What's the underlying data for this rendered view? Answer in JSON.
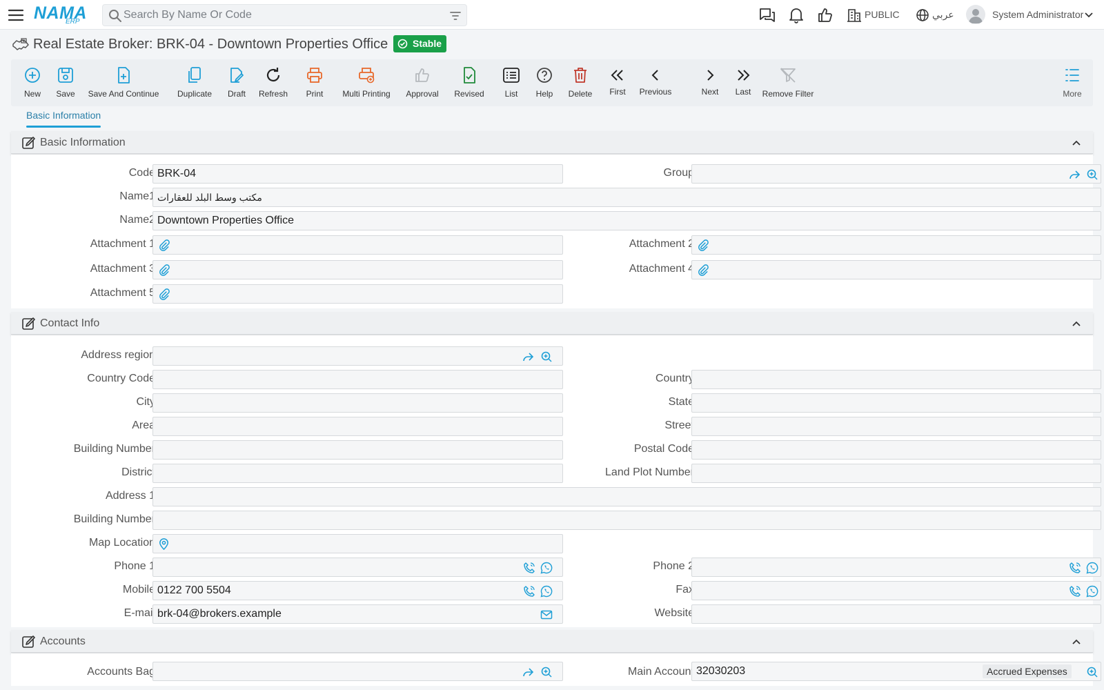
{
  "topbar": {
    "logo_main": "NAMA",
    "logo_sub": "ERP",
    "search_placeholder": "Search By Name Or Code",
    "branch": "PUBLIC",
    "language": "عربي",
    "user": "System Administrator"
  },
  "page": {
    "title": "Real Estate Broker: BRK-04 - Downtown Properties Office",
    "status": "Stable",
    "status_color": "#1aa049"
  },
  "toolbar": {
    "new": "New",
    "save": "Save",
    "save_continue": "Save And Continue",
    "duplicate": "Duplicate",
    "draft": "Draft",
    "refresh": "Refresh",
    "print": "Print",
    "multi_printing": "Multi Printing",
    "approval": "Approval",
    "revised": "Revised",
    "list": "List",
    "help": "Help",
    "delete": "Delete",
    "first": "First",
    "previous": "Previous",
    "next": "Next",
    "last": "Last",
    "remove_filter": "Remove Filter",
    "more": "More"
  },
  "tabs": {
    "basic": "Basic Information"
  },
  "colors": {
    "accent": "#1e9fd6",
    "print": "#e8682a",
    "delete": "#c0392b",
    "revised": "#1f8a3a"
  },
  "basic": {
    "title": "Basic Information",
    "code_label": "Code",
    "code_value": "BRK-04",
    "group_label": "Group",
    "group_value": "",
    "name1_label": "Name1",
    "name1_value": "مكتب وسط البلد للعقارات",
    "name2_label": "Name2",
    "name2_value": "Downtown Properties Office",
    "att1_label": "Attachment 1",
    "att2_label": "Attachment 2",
    "att3_label": "Attachment 3",
    "att4_label": "Attachment 4",
    "att5_label": "Attachment 5"
  },
  "contact": {
    "title": "Contact Info",
    "address_region_label": "Address region",
    "country_code_label": "Country Code",
    "country_label": "Country",
    "city_label": "City",
    "state_label": "State",
    "area_label": "Area",
    "street_label": "Street",
    "building_number_label": "Building Number",
    "postal_code_label": "Postal Code",
    "district_label": "District",
    "land_plot_label": "Land Plot Number",
    "address1_label": "Address 1",
    "building_number2_label": "Building Number",
    "map_location_label": "Map Location",
    "phone1_label": "Phone 1",
    "phone2_label": "Phone 2",
    "mobile_label": "Mobile",
    "mobile_value": "0122 700 5504",
    "fax_label": "Fax",
    "email_label": "E-mail",
    "email_value": "brk-04@brokers.example",
    "website_label": "Website"
  },
  "accounts": {
    "title": "Accounts",
    "accounts_bag_label": "Accounts Bag",
    "main_account_label": "Main Account",
    "main_account_value": "32030203",
    "main_account_name": "Accrued Expenses"
  }
}
